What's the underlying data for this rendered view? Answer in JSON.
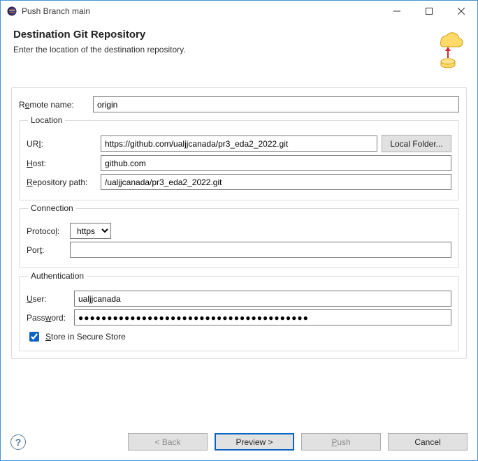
{
  "window": {
    "title": "Push Branch main"
  },
  "header": {
    "title": "Destination Git Repository",
    "subtitle": "Enter the location of the destination repository."
  },
  "remote": {
    "label_pre": "R",
    "label_u": "e",
    "label_post": "mote name:",
    "value": "origin"
  },
  "location": {
    "legend": "Location",
    "uri": {
      "label_pre": "UR",
      "label_u": "I",
      "label_post": ":",
      "value": "https://github.com/ualjjcanada/pr3_eda2_2022.git"
    },
    "local_folder": "Local Folder...",
    "host": {
      "label_u": "H",
      "label_post": "ost:",
      "value": "github.com"
    },
    "repo": {
      "label_u": "R",
      "label_post": "epository path:",
      "value": "/ualjjcanada/pr3_eda2_2022.git"
    }
  },
  "connection": {
    "legend": "Connection",
    "protocol": {
      "label_pre": "Protoco",
      "label_u": "l",
      "label_post": ":",
      "value": "https",
      "options": [
        "https"
      ]
    },
    "port": {
      "label_pre": "Por",
      "label_u": "t",
      "label_post": ":",
      "value": ""
    }
  },
  "auth": {
    "legend": "Authentication",
    "user": {
      "label_u": "U",
      "label_post": "ser:",
      "value": "ualjjcanada"
    },
    "password": {
      "label_pre": "Pass",
      "label_u": "w",
      "label_post": "ord:",
      "value": "●●●●●●●●●●●●●●●●●●●●●●●●●●●●●●●●●●●●●●●●"
    },
    "store": {
      "label_u": "S",
      "label_post": "tore in Secure Store",
      "checked": true
    }
  },
  "footer": {
    "help": "?",
    "back": "< Back",
    "preview": "Preview >",
    "push_u": "P",
    "push_post": "ush",
    "cancel": "Cancel"
  }
}
